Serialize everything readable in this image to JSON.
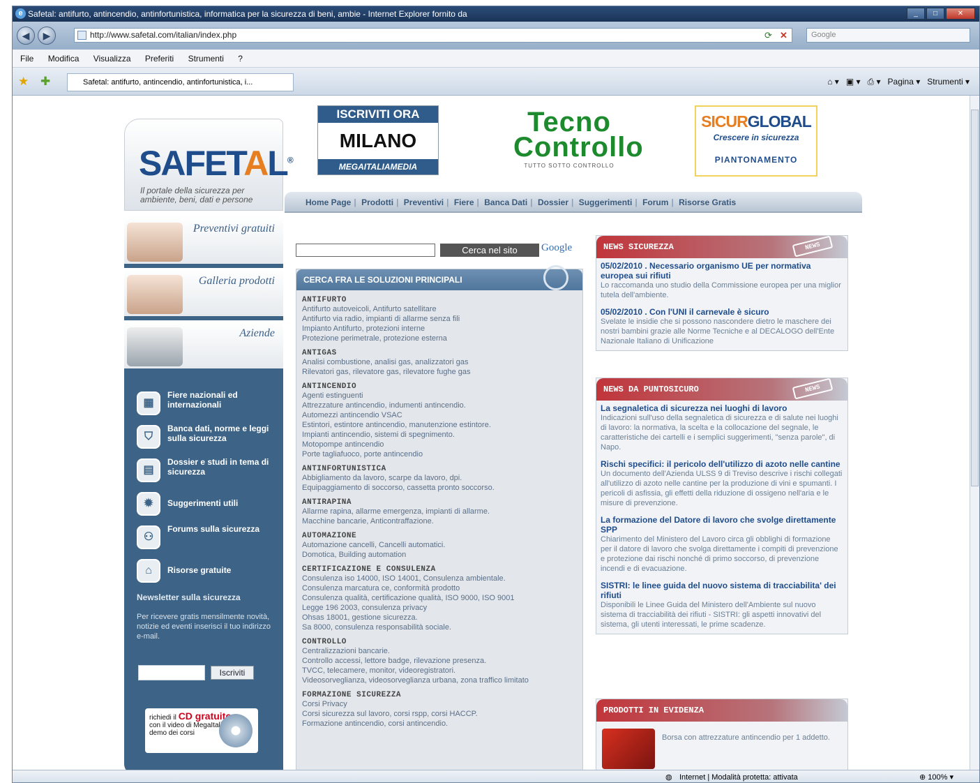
{
  "browser": {
    "title": "Safetal: antifurto, antincendio, antinfortunistica, informatica per la sicurezza di beni, ambie - Internet Explorer fornito da",
    "url": "http://www.safetal.com/italian/index.php",
    "search_placeholder": "Google",
    "menu": [
      "File",
      "Modifica",
      "Visualizza",
      "Preferiti",
      "Strumenti",
      "?"
    ],
    "tab_label": "Safetal: antifurto, antincendio, antinfortunistica, i...",
    "cmd_pagina": "Pagina",
    "cmd_strumenti": "Strumenti",
    "status_zone": "Internet | Modalità protetta: attivata",
    "zoom": "100%"
  },
  "site": {
    "logo_pre": "SAFET",
    "logo_a": "A",
    "logo_post": "L",
    "logo_reg": "®",
    "tagline": "Il portale della sicurezza per ambiente, beni, dati e persone",
    "banner1": {
      "top": "ISCRIVITI ORA",
      "main": "MILANO",
      "bottom": "MEGAITALIAMEDIA"
    },
    "banner2": {
      "l1": "Tecno",
      "l2": "Controllo",
      "l3": "TUTTO SOTTO CONTROLLO"
    },
    "banner3": {
      "l1a": "SICUR",
      "l1b": "GLOBAL",
      "l2": "Crescere in sicurezza",
      "l3": "PIANTONAMENTO"
    },
    "nav": [
      "Home Page",
      "Prodotti",
      "Preventivi",
      "Fiere",
      "Banca Dati",
      "Dossier",
      "Suggerimenti",
      "Forum",
      "Risorse Gratis"
    ]
  },
  "left": {
    "promos": [
      "Preventivi gratuiti",
      "Galleria prodotti",
      "Aziende"
    ],
    "links": [
      {
        "label": "Fiere nazionali ed internazionali",
        "icon": "calendar-icon"
      },
      {
        "label": "Banca dati, norme e leggi sulla sicurezza",
        "icon": "shield-icon"
      },
      {
        "label": "Dossier e studi in tema di sicurezza",
        "icon": "document-icon"
      },
      {
        "label": "Suggerimenti utili",
        "icon": "lightbulb-icon"
      },
      {
        "label": "Forums sulla sicurezza",
        "icon": "people-icon"
      },
      {
        "label": "Risorse gratuite",
        "icon": "lock-icon"
      }
    ],
    "newsletter": {
      "title": "Newsletter sulla sicurezza",
      "text": "Per ricevere gratis mensilmente novità, notizie ed eventi inserisci il tuo indirizzo e-mail.",
      "button": "Iscriviti"
    },
    "cd": {
      "pre": "richiedi il",
      "red": "CD gratuito",
      "text": "con il video di MegaItalia e il demo dei corsi"
    }
  },
  "center": {
    "search_button": "Cerca nel sito",
    "google": "Google",
    "header": "CERCA FRA LE SOLUZIONI PRINCIPALI",
    "categories": [
      {
        "title": "ANTIFURTO",
        "items": [
          "Antifurto autoveicoli, Antifurto satellitare",
          "Antifurto via radio, impianti di allarme senza fili",
          "Impianto Antifurto, protezioni interne",
          "Protezione perimetrale, protezione esterna"
        ]
      },
      {
        "title": "ANTIGAS",
        "items": [
          "Analisi combustione, analisi gas, analizzatori gas",
          "Rilevatori gas, rilevatore gas, rilevatore fughe gas"
        ]
      },
      {
        "title": "ANTINCENDIO",
        "items": [
          "Agenti estinguenti",
          "Attrezzature antincendio, indumenti antincendio.",
          "Automezzi antincendio VSAC",
          "Estintori, estintore antincendio, manutenzione estintore.",
          "Impianti antincendio, sistemi di spegnimento.",
          "Motopompe antincendio",
          "Porte tagliafuoco, porte antincendio"
        ]
      },
      {
        "title": "ANTINFORTUNISTICA",
        "items": [
          "Abbigliamento da lavoro, scarpe da lavoro, dpi.",
          "Equipaggiamento di soccorso, cassetta pronto soccorso."
        ]
      },
      {
        "title": "ANTIRAPINA",
        "items": [
          "Allarme rapina, allarme emergenza, impianti di allarme.",
          "Macchine bancarie, Anticontraffazione."
        ]
      },
      {
        "title": "AUTOMAZIONE",
        "items": [
          "Automazione cancelli, Cancelli automatici.",
          "Domotica, Building automation"
        ]
      },
      {
        "title": "CERTIFICAZIONE E CONSULENZA",
        "items": [
          "Consulenza iso 14000, ISO 14001, Consulenza ambientale.",
          "Consulenza marcatura ce, conformità prodotto",
          "Consulenza qualità, certificazione qualità, ISO 9000, ISO 9001",
          "Legge 196 2003, consulenza privacy",
          "Ohsas 18001, gestione sicurezza.",
          "Sa 8000, consulenza responsabilità sociale."
        ]
      },
      {
        "title": "CONTROLLO",
        "items": [
          "Centralizzazioni bancarie.",
          "Controllo accessi, lettore badge, rilevazione presenza.",
          "TVCC, telecamere, monitor, videoregistratori.",
          "Videosorveglianza, videosorveglianza urbana, zona traffico limitato"
        ]
      },
      {
        "title": "FORMAZIONE SICUREZZA",
        "items": [
          "Corsi Privacy",
          "Corsi sicurezza sul lavoro, corsi rspp, corsi HACCP.",
          "Formazione antincendio, corsi antincendio."
        ]
      }
    ]
  },
  "right": {
    "news1": {
      "header": "NEWS SICUREZZA",
      "badge": "NEWS",
      "items": [
        {
          "title": "05/02/2010 . Necessario organismo UE per normativa europea sui rifiuti",
          "desc": "Lo raccomanda uno studio della Commissione europea per una miglior tutela dell'ambiente."
        },
        {
          "title": "05/02/2010 . Con l'UNI il carnevale è sicuro",
          "desc": "Svelate le insidie che si possono nascondere dietro le maschere dei nostri bambini grazie alle Norme Tecniche e al DECALOGO dell'Ente Nazionale Italiano di Unificazione"
        }
      ]
    },
    "news2": {
      "header": "NEWS DA PUNTOSICURO",
      "badge": "NEWS",
      "items": [
        {
          "title": "La segnaletica di sicurezza nei luoghi di lavoro",
          "desc": "Indicazioni sull'uso della segnaletica di sicurezza e di salute nei luoghi di lavoro: la normativa, la scelta e la collocazione del segnale, le caratteristiche dei cartelli e i semplici suggerimenti, \"senza parole\", di Napo."
        },
        {
          "title": "Rischi specifici: il pericolo dell'utilizzo di azoto nelle cantine",
          "desc": "Un documento dell'Azienda ULSS 9 di Treviso descrive i rischi collegati all'utilizzo di azoto nelle cantine per la produzione di vini e spumanti. I pericoli di asfissia, gli effetti della riduzione di ossigeno nell'aria e le misure di prevenzione."
        },
        {
          "title": "La formazione del Datore di lavoro che svolge direttamente SPP",
          "desc": "Chiarimento del Ministero del Lavoro circa gli obblighi di formazione per il datore di lavoro che svolga direttamente i compiti di prevenzione e protezione dai rischi nonché di primo soccorso, di prevenzione incendi e di evacuazione."
        },
        {
          "title": "SISTRI: le linee guida del nuovo sistema di tracciabilita' dei rifiuti",
          "desc": "Disponibili le Linee Guida del Ministero dell'Ambiente sul nuovo sistema di tracciabilità dei rifiuti - SISTRI: gli aspetti innovativi del sistema, gli utenti interessati, le prime scadenze."
        }
      ]
    },
    "products": {
      "header": "PRODOTTI IN EVIDENZA",
      "item": "Borsa con attrezzature antincendio per 1 addetto."
    }
  }
}
